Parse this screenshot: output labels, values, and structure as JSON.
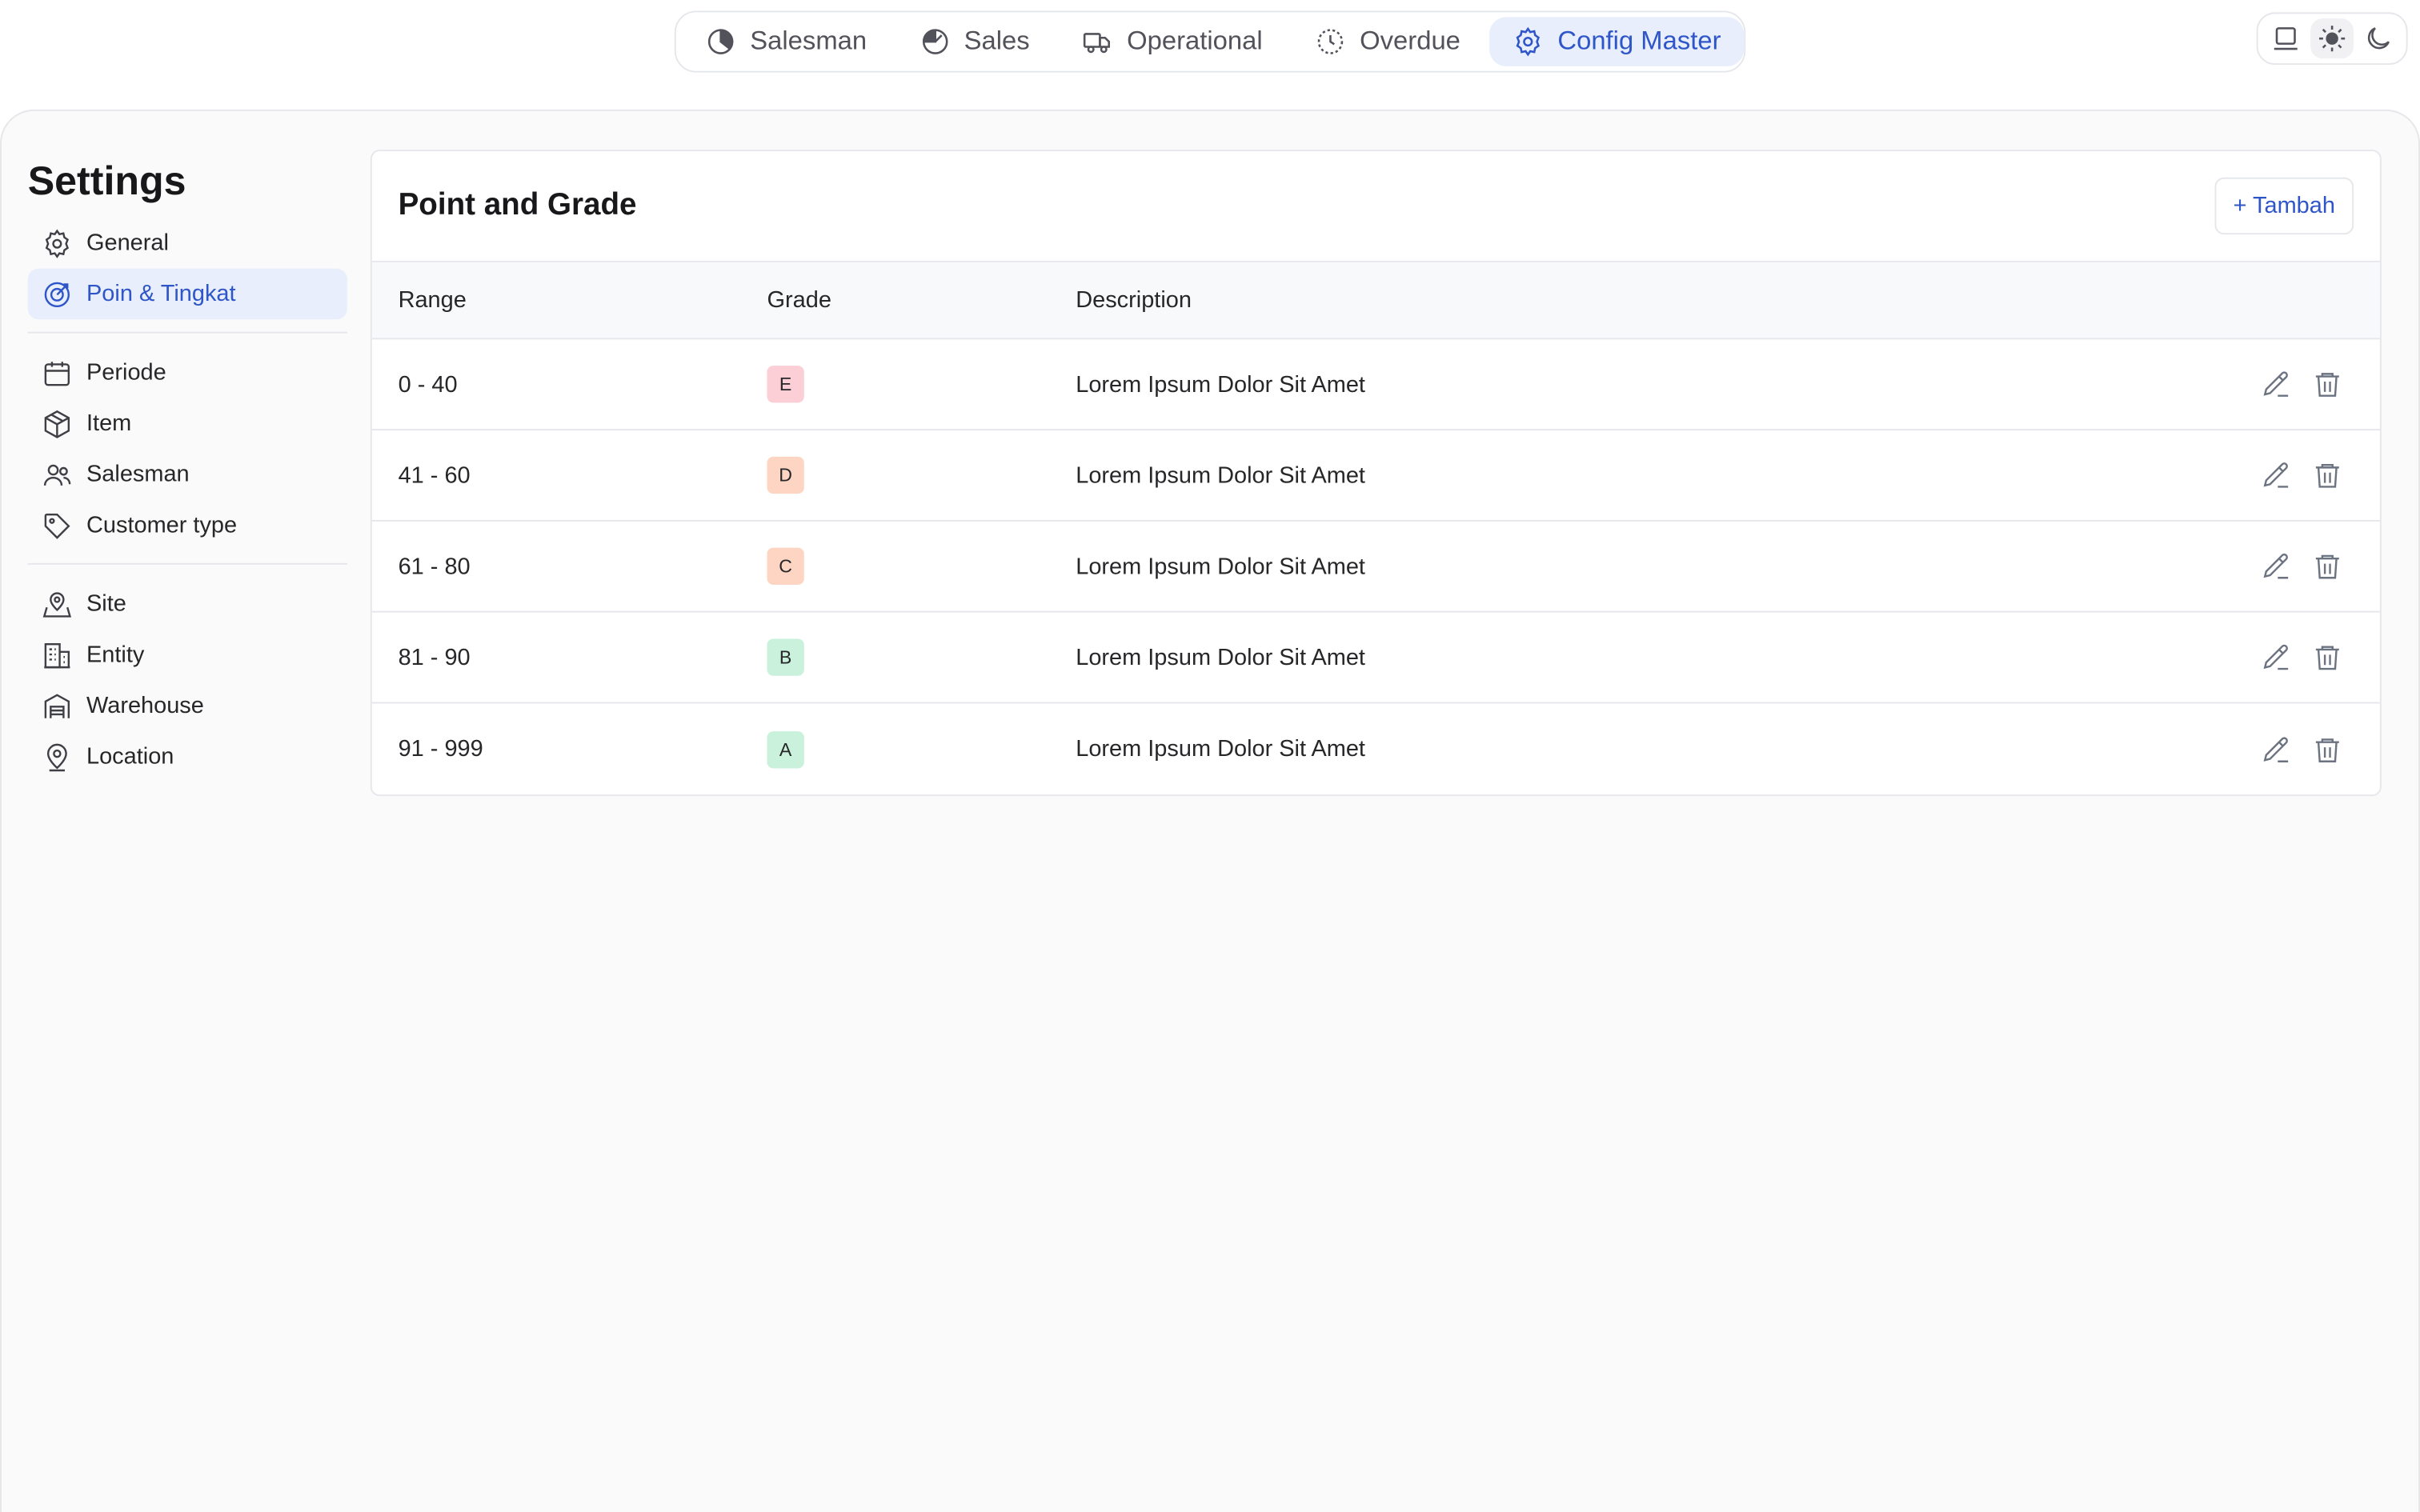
{
  "topnav": {
    "items": [
      {
        "label": "Salesman",
        "icon": "pie-chart-icon"
      },
      {
        "label": "Sales",
        "icon": "gauge-icon"
      },
      {
        "label": "Operational",
        "icon": "truck-icon"
      },
      {
        "label": "Overdue",
        "icon": "clock-icon"
      },
      {
        "label": "Config Master",
        "icon": "gear-icon",
        "active": true
      }
    ]
  },
  "theme": {
    "options": [
      "system-icon",
      "sun-icon",
      "moon-icon"
    ],
    "selected": "sun-icon"
  },
  "settings": {
    "title": "Settings",
    "groups": [
      [
        {
          "label": "General",
          "icon": "gear-icon"
        },
        {
          "label": "Poin & Tingkat",
          "icon": "target-icon",
          "active": true
        }
      ],
      [
        {
          "label": "Periode",
          "icon": "calendar-icon"
        },
        {
          "label": "Item",
          "icon": "box-icon"
        },
        {
          "label": "Salesman",
          "icon": "users-icon"
        },
        {
          "label": "Customer type",
          "icon": "tag-icon"
        }
      ],
      [
        {
          "label": "Site",
          "icon": "map-pin-icon"
        },
        {
          "label": "Entity",
          "icon": "building-icon"
        },
        {
          "label": "Warehouse",
          "icon": "warehouse-icon"
        },
        {
          "label": "Location",
          "icon": "location-icon"
        }
      ]
    ]
  },
  "card": {
    "title": "Point and Grade",
    "add_label": "+ Tambah",
    "columns": {
      "range": "Range",
      "grade": "Grade",
      "description": "Description"
    },
    "rows": [
      {
        "range": "0 - 40",
        "grade": "E",
        "grade_color": "#fccfd6",
        "description": "Lorem Ipsum Dolor Sit Amet"
      },
      {
        "range": "41 - 60",
        "grade": "D",
        "grade_color": "#fdd5c2",
        "description": "Lorem Ipsum Dolor Sit Amet"
      },
      {
        "range": "61 - 80",
        "grade": "C",
        "grade_color": "#fdd5c2",
        "description": "Lorem Ipsum Dolor Sit Amet"
      },
      {
        "range": "81 - 90",
        "grade": "B",
        "grade_color": "#c9f1dc",
        "description": "Lorem Ipsum Dolor Sit Amet"
      },
      {
        "range": "91 - 999",
        "grade": "A",
        "grade_color": "#c9f1dc",
        "description": "Lorem Ipsum Dolor Sit Amet"
      }
    ]
  }
}
